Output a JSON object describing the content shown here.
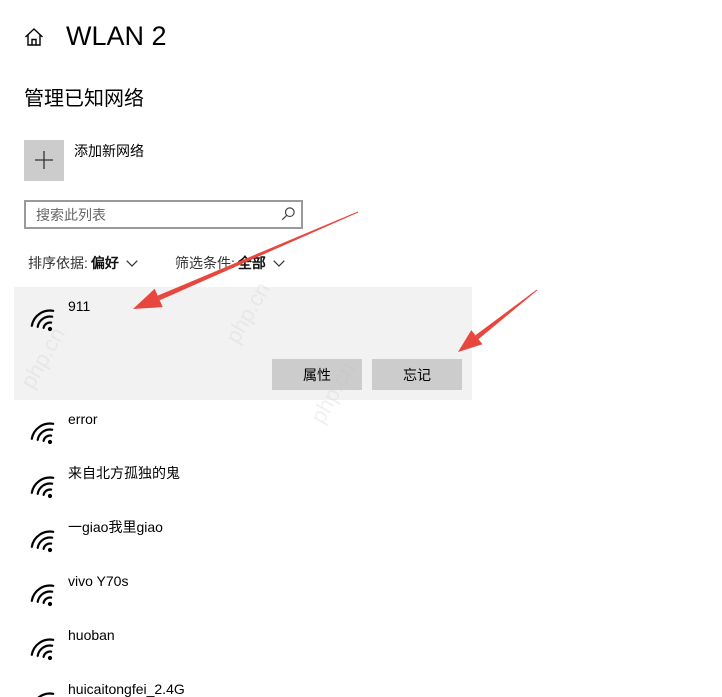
{
  "header": {
    "title": "WLAN 2"
  },
  "section": {
    "title": "管理已知网络"
  },
  "add_network": {
    "label": "添加新网络"
  },
  "search": {
    "placeholder": "搜索此列表"
  },
  "sort": {
    "label": "排序依据:",
    "value": "偏好"
  },
  "filter": {
    "label": "筛选条件:",
    "value": "全部"
  },
  "selected_network": {
    "name": "911",
    "actions": {
      "properties": "属性",
      "forget": "忘记"
    }
  },
  "other_networks": [
    {
      "name": "error"
    },
    {
      "name": "来自北方孤独的鬼"
    },
    {
      "name": "一giao我里giao"
    },
    {
      "name": "vivo Y70s"
    },
    {
      "name": "huoban"
    },
    {
      "name": "huicaitongfei_2.4G"
    }
  ],
  "icons": {
    "home": "home-icon",
    "add": "plus-icon",
    "search": "search-icon",
    "network": "wifi-icon",
    "dropdown": "chevron-down-icon"
  },
  "colors": {
    "annotation_arrow": "#e8473e",
    "selected_background": "#f2f2f2",
    "button_background": "#cccccc"
  },
  "watermark": "php.cn"
}
